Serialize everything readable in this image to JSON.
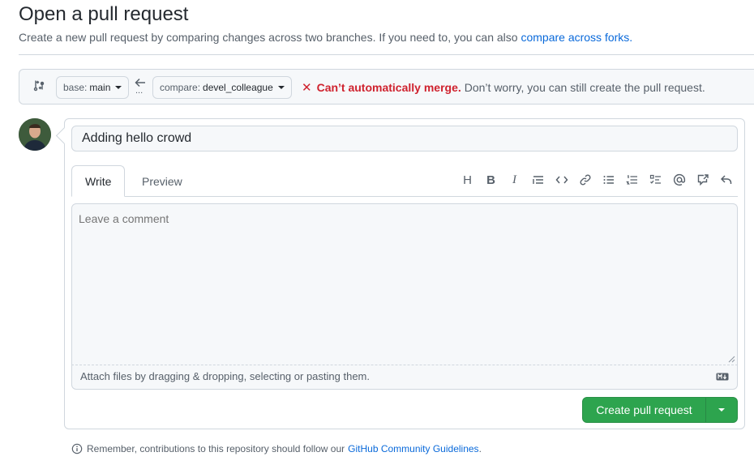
{
  "header": {
    "title": "Open a pull request",
    "subtitle": "Create a new pull request by comparing changes across two branches. If you need to, you can also",
    "subtitle_link": "compare across forks."
  },
  "range": {
    "base_label": "base:",
    "base_value": "main",
    "compare_label": "compare:",
    "compare_value": "devel_colleague",
    "dots": "...",
    "merge_warning": "Can’t automatically merge.",
    "merge_info": "Don’t worry, you can still create the pull request."
  },
  "form": {
    "title_value": "Adding hello crowd",
    "tabs": [
      "Write",
      "Preview"
    ],
    "comment_placeholder": "Leave a comment",
    "attach_text": "Attach files by dragging & dropping, selecting or pasting them.",
    "toolbar": {
      "heading": "H",
      "bold": "B",
      "italic": "I"
    },
    "submit_label": "Create pull request"
  },
  "footer": {
    "note": "Remember, contributions to this repository should follow our",
    "link": "GitHub Community Guidelines",
    "tail": "."
  },
  "colors": {
    "accent": "#0969da",
    "danger": "#cf222e",
    "success": "#2da44e"
  }
}
